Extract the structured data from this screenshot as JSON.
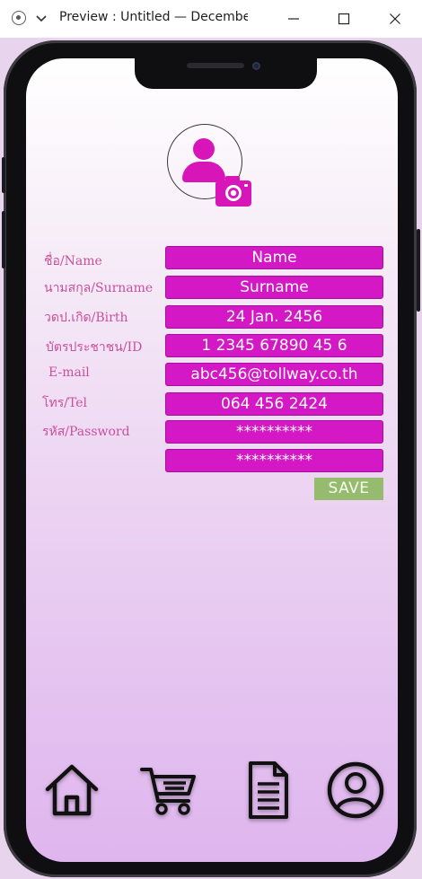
{
  "window": {
    "title": "Preview : Untitled — December",
    "controls": {
      "minimize_icon": "minimize-icon",
      "maximize_icon": "maximize-icon",
      "close_icon": "close-icon"
    }
  },
  "colors": {
    "accent": "#d418c5",
    "label": "#c9509c",
    "save": "#97bb6e",
    "screen_top": "#ffffff",
    "screen_bottom": "#dfb5ee"
  },
  "profile": {
    "avatar_icon": "user-icon",
    "camera_icon": "camera-icon"
  },
  "form": {
    "fields": [
      {
        "label": "ชื่อ/Name",
        "value": "Name"
      },
      {
        "label": "นามสกุล/Surname",
        "value": "Surname"
      },
      {
        "label": "วดป.เกิด/Birth",
        "value": "24 Jan. 2456"
      },
      {
        "label": "บัตรประชาชน/ID",
        "value": "1 2345 67890 45 6"
      },
      {
        "label": "E-mail",
        "value": "abc456@tollway.co.th"
      },
      {
        "label": "โทร/Tel",
        "value": "064 456 2424"
      },
      {
        "label": "รหัส/Password",
        "value": "**********"
      },
      {
        "label": "",
        "value": "**********"
      }
    ],
    "save_label": "SAVE"
  },
  "nav": {
    "items": [
      {
        "icon": "home-icon"
      },
      {
        "icon": "cart-icon"
      },
      {
        "icon": "document-icon"
      },
      {
        "icon": "profile-icon"
      }
    ]
  }
}
